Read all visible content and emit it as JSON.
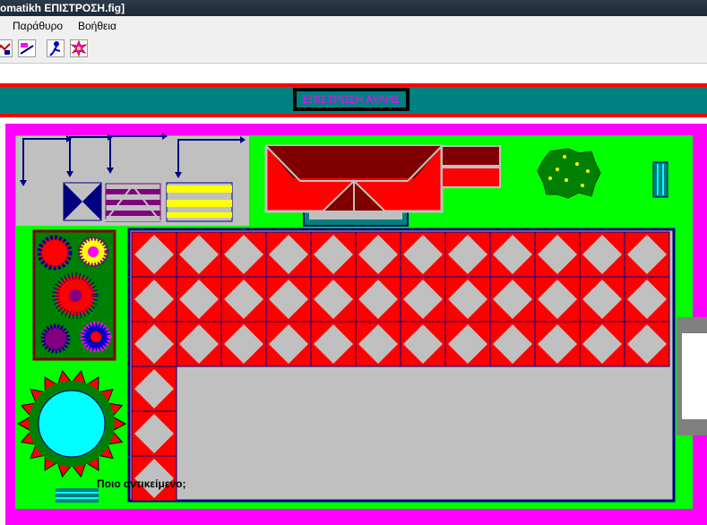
{
  "window": {
    "title": "omatikh ΕΠΙΣΤΡΟΣΗ.fig]"
  },
  "menu": {
    "items": [
      "Παράθυρο",
      "Βοήθεια"
    ]
  },
  "toolbar": {
    "buttons": [
      "edit-tool-icon",
      "insert-tool-icon",
      "figure-tool-icon",
      "burst-tool-icon"
    ]
  },
  "scene": {
    "title": "ΕΠΙΣΤΡΩΣΗ ΑΥΛΗΣ",
    "question": "Ποιο αντικείμενο;"
  },
  "colors": {
    "band": "#008080",
    "border_red": "#ff0000",
    "frame_magenta": "#ff00ff",
    "grass": "#00ff00",
    "tile_red": "#ff0000",
    "tile_gray": "#c0c0c0",
    "navy": "#000080",
    "title_text": "#ff00ff",
    "pool": "#00ffff"
  }
}
